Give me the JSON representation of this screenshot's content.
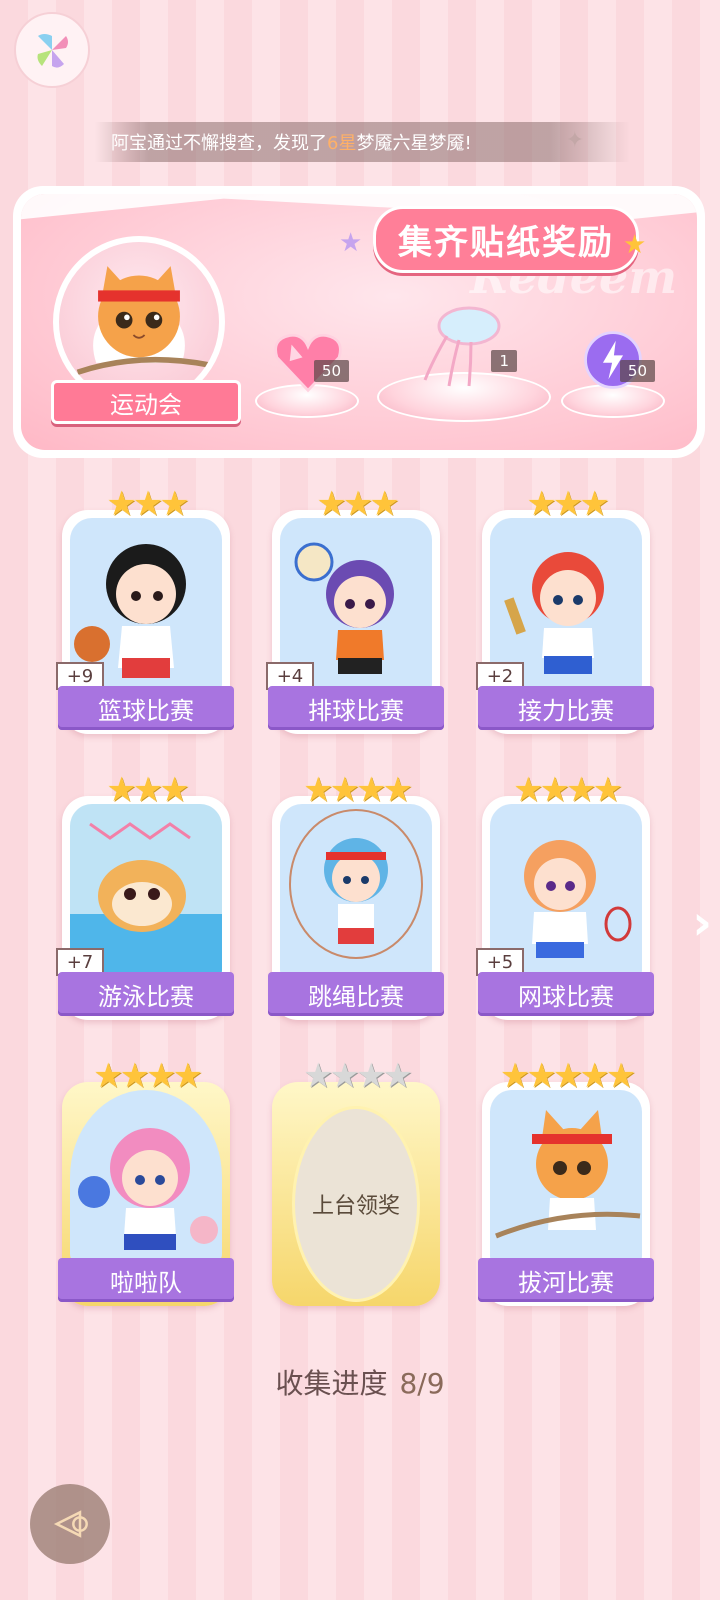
{
  "ticker": {
    "prefix": "阿宝通过不懈搜查，发现了",
    "highlight": "6星",
    "suffix": "梦魇六星梦魇!"
  },
  "banner": {
    "title": "集齐贴纸奖励",
    "bg_word": "Redeem",
    "event_name": "运动会",
    "rewards": [
      {
        "icon": "heart-gem-icon",
        "count": "50"
      },
      {
        "icon": "jellyfish-icon",
        "count": "1"
      },
      {
        "icon": "energy-orb-icon",
        "count": "50"
      }
    ]
  },
  "cards": [
    {
      "name": "篮球比赛",
      "stars": 3,
      "plus": "+9",
      "color": "#cfe6fb"
    },
    {
      "name": "排球比赛",
      "stars": 3,
      "plus": "+4",
      "color": "#cfe6fb"
    },
    {
      "name": "接力比赛",
      "stars": 3,
      "plus": "+2",
      "color": "#cfe6fb"
    },
    {
      "name": "游泳比赛",
      "stars": 3,
      "plus": "+7",
      "color": "#cfe6fb"
    },
    {
      "name": "跳绳比赛",
      "stars": 4,
      "plus": "",
      "color": "#cfe6fb"
    },
    {
      "name": "网球比赛",
      "stars": 4,
      "plus": "+5",
      "color": "#cfe6fb"
    },
    {
      "name": "啦啦队",
      "stars": 4,
      "plus": "",
      "color": "#cfe6fb"
    },
    {
      "name": "上台领奖",
      "stars": 4,
      "plus": "",
      "locked": true
    },
    {
      "name": "拔河比赛",
      "stars": 5,
      "plus": "",
      "color": "#cfe6fb"
    }
  ],
  "progress": {
    "label": "收集进度",
    "value": "8/9"
  },
  "colors": {
    "accent_purple": "#a874e0",
    "accent_pink": "#ff7f98",
    "star_gold": "#ffc43a"
  }
}
